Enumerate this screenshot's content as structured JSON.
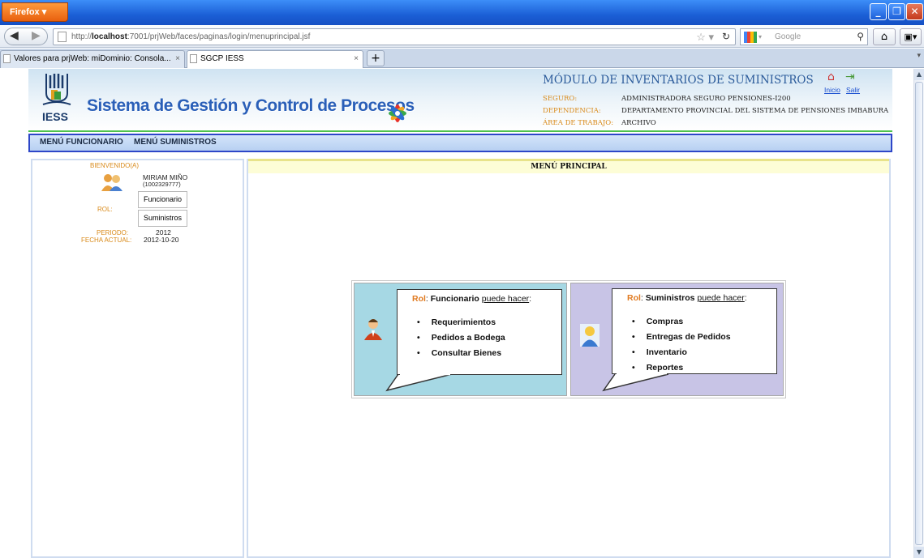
{
  "browser": {
    "menu_button": "Firefox",
    "url_prefix": "http://",
    "url_host": "localhost",
    "url_rest": ":7001/prjWeb/faces/paginas/login/menuprincipal.jsf",
    "search_placeholder": "Google",
    "tabs": [
      {
        "label": "Valores para prjWeb: miDominio: Consola..."
      },
      {
        "label": "SGCP IESS"
      }
    ]
  },
  "header": {
    "logo_text": "IESS",
    "system_name": "Sistema de Gestión y Control de Procesos",
    "module_title": "MÓDULO DE INVENTARIOS DE SUMINISTROS",
    "inicio_link": "Inicio",
    "salir_link": "Salir",
    "info": [
      {
        "label": "SEGURO:",
        "value": "ADMINISTRADORA SEGURO PENSIONES-I200"
      },
      {
        "label": "DEPENDENCIA:",
        "value": "DEPARTAMENTO PROVINCIAL DEL SISTEMA DE PENSIONES IMBABURA"
      },
      {
        "label": "ÁREA DE TRABAJO:",
        "value": "ARCHIVO"
      }
    ]
  },
  "menu": {
    "items": [
      {
        "label": "MENÚ FUNCIONARIO"
      },
      {
        "label": "MENÚ SUMINISTROS"
      }
    ]
  },
  "sidebar": {
    "welcome_label": "BIENVENIDO(A)",
    "user_name": "MIRIAM MIÑO",
    "user_id": "(1002329777)",
    "rol_label": "ROL:",
    "roles": [
      "Funcionario",
      "Suministros"
    ],
    "period_label": "PERIODO:",
    "period_value": "2012",
    "date_label": "FECHA ACTUAL:",
    "date_value": "2012-10-20"
  },
  "main": {
    "title": "MENÚ PRINCIPAL",
    "panels": [
      {
        "rol_word": "Rol",
        "role_name": "Funcionario",
        "can_do": "puede hacer",
        "items": [
          "Requerimientos",
          "Pedidos a Bodega",
          "Consultar Bienes"
        ]
      },
      {
        "rol_word": "Rol",
        "role_name": "Suministros",
        "can_do": "puede hacer",
        "items": [
          "Compras",
          "Entregas de Pedidos",
          "Inventario",
          "Reportes"
        ]
      }
    ]
  },
  "colors": {
    "rol_accent": "#e07a20",
    "funcionario_panel": "#a6d8e4",
    "suministros_panel": "#c8c4e6",
    "menubar_border": "#2d46c8",
    "label_orange": "#d98a1a"
  }
}
